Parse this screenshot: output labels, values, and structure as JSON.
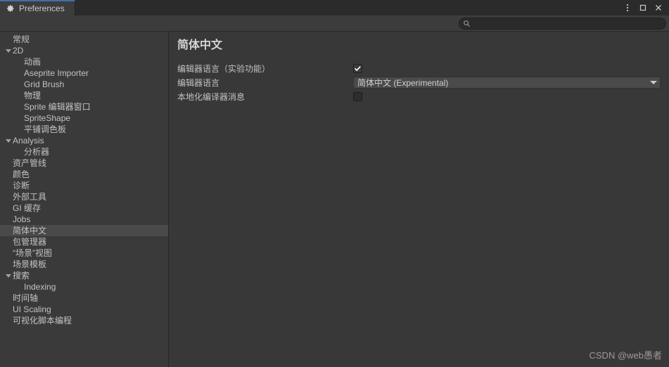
{
  "window": {
    "tab_title": "Preferences",
    "tab_icon": "gear-icon",
    "buttons": {
      "menu": "more-options-icon",
      "maximize": "maximize-icon",
      "close": "close-icon"
    }
  },
  "toolbar": {
    "search_value": "",
    "search_placeholder": "",
    "search_icon": "search-icon"
  },
  "sidebar": {
    "items": [
      {
        "label": "常规",
        "depth": 0,
        "expandable": false,
        "selected": false
      },
      {
        "label": "2D",
        "depth": 0,
        "expandable": true,
        "selected": false
      },
      {
        "label": "动画",
        "depth": 1,
        "expandable": false,
        "selected": false
      },
      {
        "label": "Aseprite Importer",
        "depth": 1,
        "expandable": false,
        "selected": false
      },
      {
        "label": "Grid Brush",
        "depth": 1,
        "expandable": false,
        "selected": false
      },
      {
        "label": "物理",
        "depth": 1,
        "expandable": false,
        "selected": false
      },
      {
        "label": "Sprite 编辑器窗口",
        "depth": 1,
        "expandable": false,
        "selected": false
      },
      {
        "label": "SpriteShape",
        "depth": 1,
        "expandable": false,
        "selected": false
      },
      {
        "label": "平铺调色板",
        "depth": 1,
        "expandable": false,
        "selected": false
      },
      {
        "label": "Analysis",
        "depth": 0,
        "expandable": true,
        "selected": false
      },
      {
        "label": "分析器",
        "depth": 1,
        "expandable": false,
        "selected": false
      },
      {
        "label": "资产管线",
        "depth": 0,
        "expandable": false,
        "selected": false
      },
      {
        "label": "颜色",
        "depth": 0,
        "expandable": false,
        "selected": false
      },
      {
        "label": "诊断",
        "depth": 0,
        "expandable": false,
        "selected": false
      },
      {
        "label": "外部工具",
        "depth": 0,
        "expandable": false,
        "selected": false
      },
      {
        "label": "GI 缓存",
        "depth": 0,
        "expandable": false,
        "selected": false
      },
      {
        "label": "Jobs",
        "depth": 0,
        "expandable": false,
        "selected": false
      },
      {
        "label": "简体中文",
        "depth": 0,
        "expandable": false,
        "selected": true
      },
      {
        "label": "包管理器",
        "depth": 0,
        "expandable": false,
        "selected": false
      },
      {
        "label": "“场景”视图",
        "depth": 0,
        "expandable": false,
        "selected": false
      },
      {
        "label": "场景模板",
        "depth": 0,
        "expandable": false,
        "selected": false
      },
      {
        "label": "搜索",
        "depth": 0,
        "expandable": true,
        "selected": false
      },
      {
        "label": "Indexing",
        "depth": 1,
        "expandable": false,
        "selected": false
      },
      {
        "label": "时间轴",
        "depth": 0,
        "expandable": false,
        "selected": false
      },
      {
        "label": "UI Scaling",
        "depth": 0,
        "expandable": false,
        "selected": false
      },
      {
        "label": "可视化脚本编程",
        "depth": 0,
        "expandable": false,
        "selected": false
      }
    ]
  },
  "main": {
    "title": "简体中文",
    "rows": [
      {
        "label": "编辑器语言（实验功能）",
        "type": "checkbox",
        "checked": true
      },
      {
        "label": "编辑器语言",
        "type": "dropdown",
        "value": "简体中文 (Experimental)"
      },
      {
        "label": "本地化编译器消息",
        "type": "checkbox",
        "checked": false
      }
    ]
  },
  "watermark": "CSDN @web愚者",
  "colors": {
    "window_bg": "#383838",
    "titlebar_bg": "#2b2b2b",
    "tab_bg": "#3c3c3c",
    "tab_accent": "#3e6fb0",
    "sidebar_bg": "#3a3a3a",
    "selection": "#4a4a4a",
    "text": "#c2c2c2",
    "field_bg": "#4a4a4a"
  }
}
